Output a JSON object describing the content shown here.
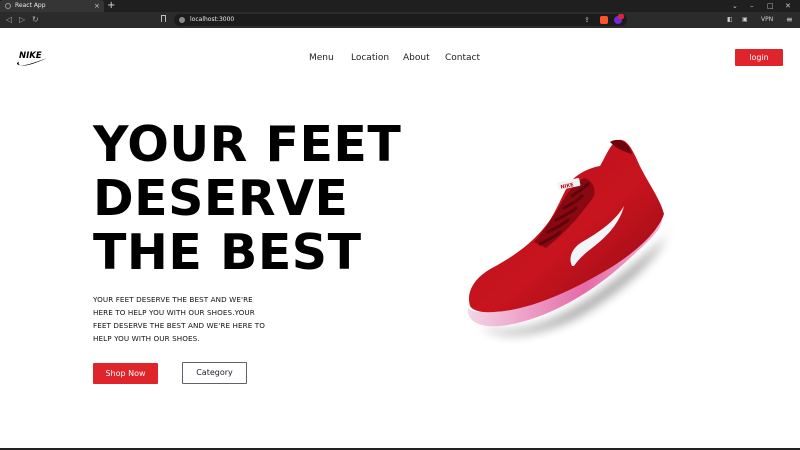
{
  "browser": {
    "tab_title": "React App",
    "tab_close": "×",
    "new_tab": "+",
    "url": "localhost:3000",
    "vpn_label": "VPN",
    "window_controls": [
      "⌄",
      "–",
      "□",
      "✕"
    ]
  },
  "nav": {
    "links": [
      "Menu",
      "Location",
      "About",
      "Contact"
    ],
    "login_label": "login"
  },
  "hero": {
    "title_lines": [
      "YOUR FEET",
      "DESERVE",
      "THE BEST"
    ],
    "description": "YOUR FEET DESERVE THE BEST AND WE'RE HERE TO HELP YOU WITH OUR SHOES.YOUR FEET DESERVE THE BEST AND WE'RE HERE TO HELP YOU WITH OUR SHOES.",
    "shop_button": "Shop Now",
    "category_button": "Category"
  },
  "colors": {
    "accent": "#e0242c",
    "text": "#000000",
    "chrome_dark": "#1f1f1f"
  },
  "icons": {
    "logo": "nike-swoosh-logo",
    "product": "red-nike-running-shoe"
  }
}
